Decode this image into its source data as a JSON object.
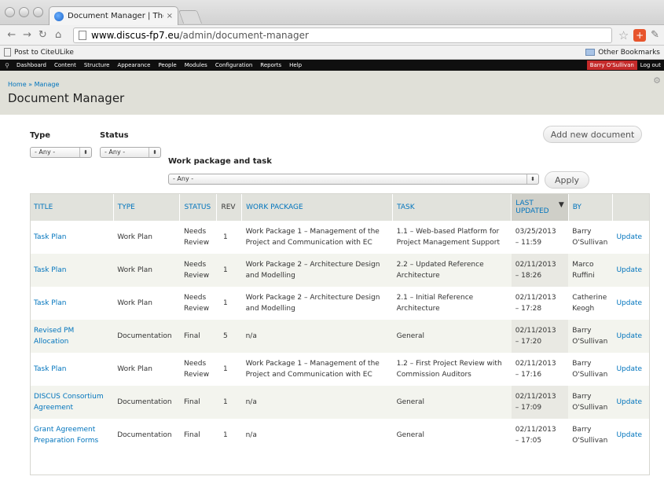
{
  "browser": {
    "tab_title": "Document Manager | The DI",
    "tab_close": "×",
    "url_host": "www.discus-fp7.eu",
    "url_path": "/admin/document-manager",
    "bookmark_left": "Post to CiteULike",
    "bookmark_right": "Other Bookmarks"
  },
  "admin_toolbar": {
    "items": [
      "Dashboard",
      "Content",
      "Structure",
      "Appearance",
      "People",
      "Modules",
      "Configuration",
      "Reports",
      "Help"
    ],
    "user": "Barry O'Sullivan",
    "logout": "Log out"
  },
  "header": {
    "breadcrumb_home": "Home",
    "breadcrumb_sep": " » ",
    "breadcrumb_manage": "Manage",
    "title": "Document Manager"
  },
  "filters": {
    "type_label": "Type",
    "type_value": "- Any -",
    "status_label": "Status",
    "status_value": "- Any -",
    "wp_label": "Work package and task",
    "wp_value": "- Any -",
    "apply": "Apply",
    "add_new": "Add new document"
  },
  "table": {
    "headers": {
      "title": "TITLE",
      "type": "TYPE",
      "status": "STATUS",
      "rev": "REV",
      "work_package": "WORK PACKAGE",
      "task": "TASK",
      "last_updated_1": "LAST",
      "last_updated_2": "UPDATED",
      "by": "BY"
    },
    "rows": [
      {
        "title": "Task Plan",
        "type": "Work Plan",
        "status1": "Needs",
        "status2": "Review",
        "rev": "1",
        "wp1": "Work Package 1 – Management of the",
        "wp2": "Project and Communication with EC",
        "task1": "1.1 – Web-based Platform for",
        "task2": "Project Management Support",
        "upd1": "03/25/2013",
        "upd2": "– 11:59",
        "by1": "Barry",
        "by2": "O'Sullivan",
        "action": "Update"
      },
      {
        "title": "Task Plan",
        "type": "Work Plan",
        "status1": "Needs",
        "status2": "Review",
        "rev": "1",
        "wp1": "Work Package 2 – Architecture Design",
        "wp2": "and Modelling",
        "task1": "2.2 – Updated Reference",
        "task2": "Architecture",
        "upd1": "02/11/2013",
        "upd2": "– 18:26",
        "by1": "Marco",
        "by2": "Ruffini",
        "action": "Update"
      },
      {
        "title": "Task Plan",
        "type": "Work Plan",
        "status1": "Needs",
        "status2": "Review",
        "rev": "1",
        "wp1": "Work Package 2 – Architecture Design",
        "wp2": "and Modelling",
        "task1": "2.1 – Initial Reference",
        "task2": "Architecture",
        "upd1": "02/11/2013",
        "upd2": "– 17:28",
        "by1": "Catherine",
        "by2": "Keogh",
        "action": "Update"
      },
      {
        "title1": "Revised PM",
        "title2": "Allocation",
        "type": "Documentation",
        "status1": "Final",
        "status2": "",
        "rev": "5",
        "wp1": "n/a",
        "wp2": "",
        "task1": "General",
        "task2": "",
        "upd1": "02/11/2013",
        "upd2": "– 17:20",
        "by1": "Barry",
        "by2": "O'Sullivan",
        "action": "Update"
      },
      {
        "title": "Task Plan",
        "type": "Work Plan",
        "status1": "Needs",
        "status2": "Review",
        "rev": "1",
        "wp1": "Work Package 1 – Management of the",
        "wp2": "Project and Communication with EC",
        "task1": "1.2 – First Project Review with",
        "task2": "Commission Auditors",
        "upd1": "02/11/2013",
        "upd2": "– 17:16",
        "by1": "Barry",
        "by2": "O'Sullivan",
        "action": "Update"
      },
      {
        "title1": "DISCUS Consortium",
        "title2": "Agreement",
        "type": "Documentation",
        "status1": "Final",
        "status2": "",
        "rev": "1",
        "wp1": "n/a",
        "wp2": "",
        "task1": "General",
        "task2": "",
        "upd1": "02/11/2013",
        "upd2": "– 17:09",
        "by1": "Barry",
        "by2": "O'Sullivan",
        "action": "Update"
      },
      {
        "title1": "Grant Agreement",
        "title2": "Preparation Forms",
        "type": "Documentation",
        "status1": "Final",
        "status2": "",
        "rev": "1",
        "wp1": "n/a",
        "wp2": "",
        "task1": "General",
        "task2": "",
        "upd1": "02/11/2013",
        "upd2": "– 17:05",
        "by1": "Barry",
        "by2": "O'Sullivan",
        "action": "Update"
      }
    ]
  }
}
